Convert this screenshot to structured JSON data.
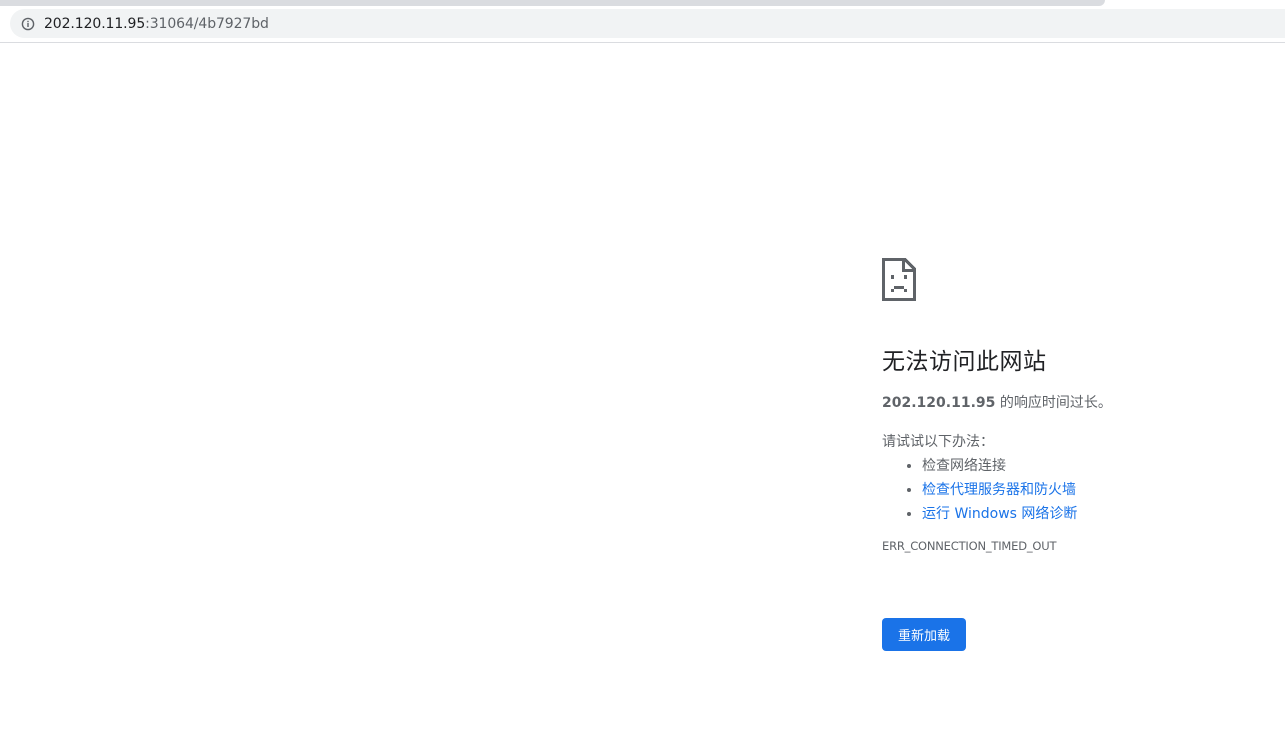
{
  "address_bar": {
    "host": "202.120.11.95",
    "rest": ":31064/4b7927bd"
  },
  "error_page": {
    "headline": "无法访问此网站",
    "host_bold": "202.120.11.95",
    "message": " 的响应时间过长。",
    "suggestions_title": "请试试以下办法：",
    "suggestions": [
      {
        "label": "检查网络连接",
        "link": false
      },
      {
        "label": "检查代理服务器和防火墙",
        "link": true
      },
      {
        "label": "运行 Windows 网络诊断",
        "link": true
      }
    ],
    "error_code": "ERR_CONNECTION_TIMED_OUT",
    "reload_label": "重新加载"
  },
  "icons": {
    "address_bar": "info-icon",
    "error": "sad-page-icon"
  },
  "colors": {
    "link": "#1a73e8",
    "button": "#1a73e8",
    "text": "#5f6368",
    "headline": "#202124"
  }
}
